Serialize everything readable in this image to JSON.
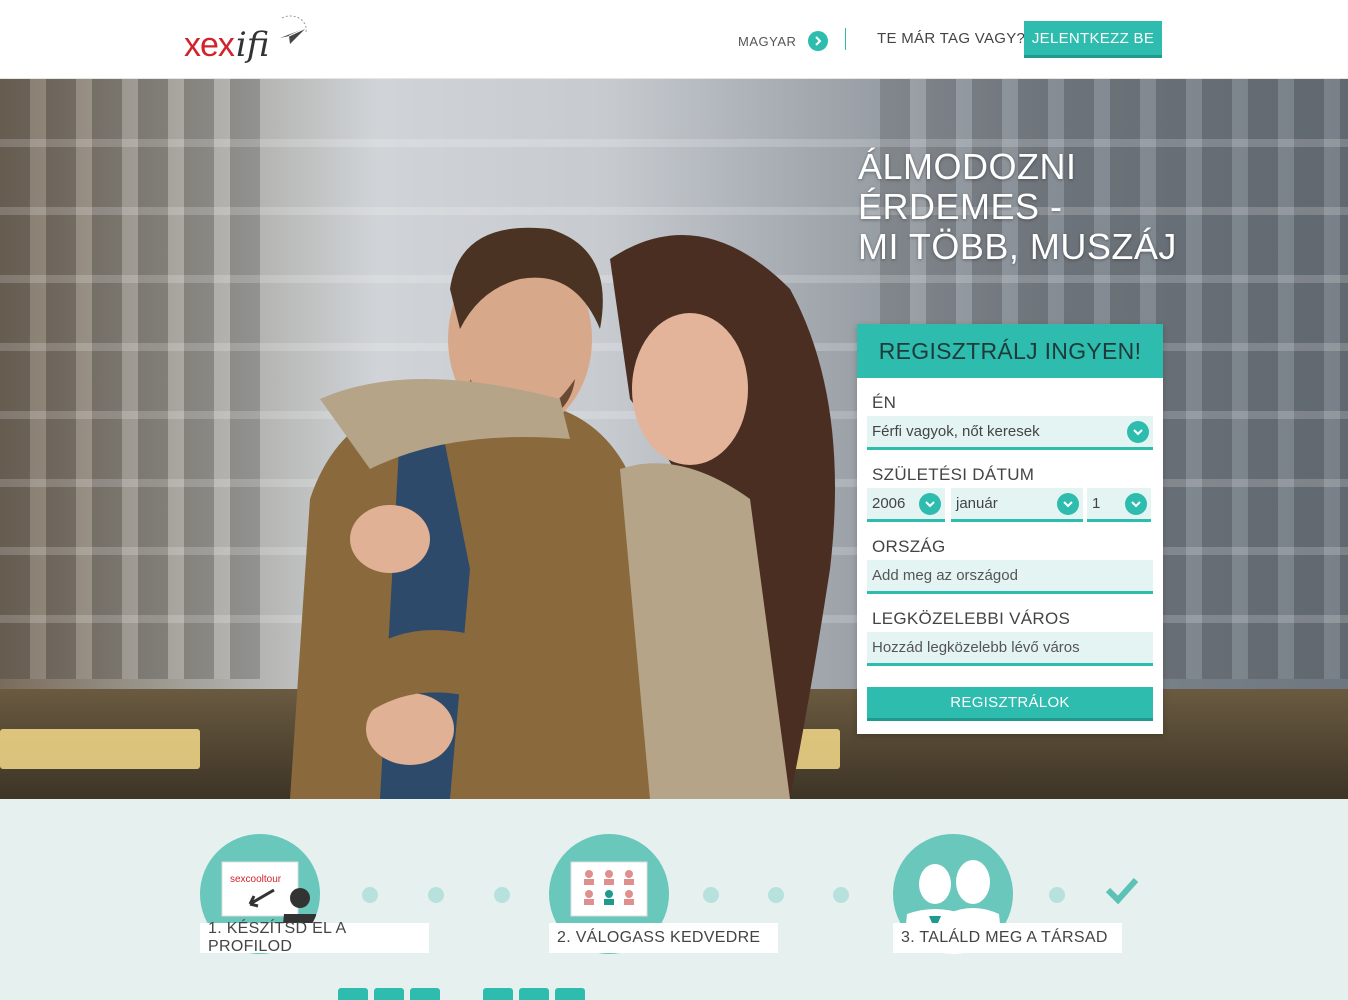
{
  "header": {
    "logo_left": "xex",
    "logo_right": "ifi",
    "language_label": "MAGYAR",
    "member_question": "TE MÁR TAG VAGY?",
    "login_button": "JELENTKEZZ BE"
  },
  "hero": {
    "title_lines": [
      "ÁLMODOZNI",
      "ÉRDEMES -",
      "MI TÖBB, MUSZÁJ"
    ]
  },
  "registration": {
    "heading": "REGISZTRÁLJ INGYEN!",
    "iam_label": "ÉN",
    "iam_value": "Férfi vagyok, nőt keresek",
    "birthdate_label": "SZÜLETÉSI DÁTUM",
    "birth_year": "2006",
    "birth_month": "január",
    "birth_day": "1",
    "country_label": "ORSZÁG",
    "country_placeholder": "Add meg az országod",
    "city_label": "LEGKÖZELEBBI VÁROS",
    "city_placeholder": "Hozzád legközelebb lévő város",
    "submit": "REGISZTRÁLOK"
  },
  "steps": [
    {
      "label": "1. KÉSZÍTSD EL A PROFILOD",
      "screen_brand": "sexcooltour"
    },
    {
      "label": "2. VÁLOGASS KEDVEDRE"
    },
    {
      "label": "3. TALÁLD MEG A TÁRSAD"
    }
  ],
  "colors": {
    "accent": "#2dbcae",
    "logo_red": "#d2232a",
    "steps_bg": "#e6f1ef"
  }
}
